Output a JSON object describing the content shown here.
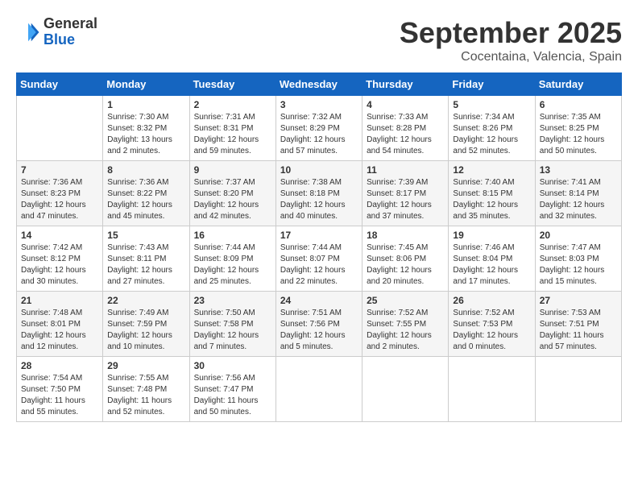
{
  "header": {
    "logo_general": "General",
    "logo_blue": "Blue",
    "month_title": "September 2025",
    "location": "Cocentaina, Valencia, Spain"
  },
  "days_of_week": [
    "Sunday",
    "Monday",
    "Tuesday",
    "Wednesday",
    "Thursday",
    "Friday",
    "Saturday"
  ],
  "weeks": [
    [
      {
        "day": "",
        "content": ""
      },
      {
        "day": "1",
        "content": "Sunrise: 7:30 AM\nSunset: 8:32 PM\nDaylight: 13 hours\nand 2 minutes."
      },
      {
        "day": "2",
        "content": "Sunrise: 7:31 AM\nSunset: 8:31 PM\nDaylight: 12 hours\nand 59 minutes."
      },
      {
        "day": "3",
        "content": "Sunrise: 7:32 AM\nSunset: 8:29 PM\nDaylight: 12 hours\nand 57 minutes."
      },
      {
        "day": "4",
        "content": "Sunrise: 7:33 AM\nSunset: 8:28 PM\nDaylight: 12 hours\nand 54 minutes."
      },
      {
        "day": "5",
        "content": "Sunrise: 7:34 AM\nSunset: 8:26 PM\nDaylight: 12 hours\nand 52 minutes."
      },
      {
        "day": "6",
        "content": "Sunrise: 7:35 AM\nSunset: 8:25 PM\nDaylight: 12 hours\nand 50 minutes."
      }
    ],
    [
      {
        "day": "7",
        "content": "Sunrise: 7:36 AM\nSunset: 8:23 PM\nDaylight: 12 hours\nand 47 minutes."
      },
      {
        "day": "8",
        "content": "Sunrise: 7:36 AM\nSunset: 8:22 PM\nDaylight: 12 hours\nand 45 minutes."
      },
      {
        "day": "9",
        "content": "Sunrise: 7:37 AM\nSunset: 8:20 PM\nDaylight: 12 hours\nand 42 minutes."
      },
      {
        "day": "10",
        "content": "Sunrise: 7:38 AM\nSunset: 8:18 PM\nDaylight: 12 hours\nand 40 minutes."
      },
      {
        "day": "11",
        "content": "Sunrise: 7:39 AM\nSunset: 8:17 PM\nDaylight: 12 hours\nand 37 minutes."
      },
      {
        "day": "12",
        "content": "Sunrise: 7:40 AM\nSunset: 8:15 PM\nDaylight: 12 hours\nand 35 minutes."
      },
      {
        "day": "13",
        "content": "Sunrise: 7:41 AM\nSunset: 8:14 PM\nDaylight: 12 hours\nand 32 minutes."
      }
    ],
    [
      {
        "day": "14",
        "content": "Sunrise: 7:42 AM\nSunset: 8:12 PM\nDaylight: 12 hours\nand 30 minutes."
      },
      {
        "day": "15",
        "content": "Sunrise: 7:43 AM\nSunset: 8:11 PM\nDaylight: 12 hours\nand 27 minutes."
      },
      {
        "day": "16",
        "content": "Sunrise: 7:44 AM\nSunset: 8:09 PM\nDaylight: 12 hours\nand 25 minutes."
      },
      {
        "day": "17",
        "content": "Sunrise: 7:44 AM\nSunset: 8:07 PM\nDaylight: 12 hours\nand 22 minutes."
      },
      {
        "day": "18",
        "content": "Sunrise: 7:45 AM\nSunset: 8:06 PM\nDaylight: 12 hours\nand 20 minutes."
      },
      {
        "day": "19",
        "content": "Sunrise: 7:46 AM\nSunset: 8:04 PM\nDaylight: 12 hours\nand 17 minutes."
      },
      {
        "day": "20",
        "content": "Sunrise: 7:47 AM\nSunset: 8:03 PM\nDaylight: 12 hours\nand 15 minutes."
      }
    ],
    [
      {
        "day": "21",
        "content": "Sunrise: 7:48 AM\nSunset: 8:01 PM\nDaylight: 12 hours\nand 12 minutes."
      },
      {
        "day": "22",
        "content": "Sunrise: 7:49 AM\nSunset: 7:59 PM\nDaylight: 12 hours\nand 10 minutes."
      },
      {
        "day": "23",
        "content": "Sunrise: 7:50 AM\nSunset: 7:58 PM\nDaylight: 12 hours\nand 7 minutes."
      },
      {
        "day": "24",
        "content": "Sunrise: 7:51 AM\nSunset: 7:56 PM\nDaylight: 12 hours\nand 5 minutes."
      },
      {
        "day": "25",
        "content": "Sunrise: 7:52 AM\nSunset: 7:55 PM\nDaylight: 12 hours\nand 2 minutes."
      },
      {
        "day": "26",
        "content": "Sunrise: 7:52 AM\nSunset: 7:53 PM\nDaylight: 12 hours\nand 0 minutes."
      },
      {
        "day": "27",
        "content": "Sunrise: 7:53 AM\nSunset: 7:51 PM\nDaylight: 11 hours\nand 57 minutes."
      }
    ],
    [
      {
        "day": "28",
        "content": "Sunrise: 7:54 AM\nSunset: 7:50 PM\nDaylight: 11 hours\nand 55 minutes."
      },
      {
        "day": "29",
        "content": "Sunrise: 7:55 AM\nSunset: 7:48 PM\nDaylight: 11 hours\nand 52 minutes."
      },
      {
        "day": "30",
        "content": "Sunrise: 7:56 AM\nSunset: 7:47 PM\nDaylight: 11 hours\nand 50 minutes."
      },
      {
        "day": "",
        "content": ""
      },
      {
        "day": "",
        "content": ""
      },
      {
        "day": "",
        "content": ""
      },
      {
        "day": "",
        "content": ""
      }
    ]
  ]
}
